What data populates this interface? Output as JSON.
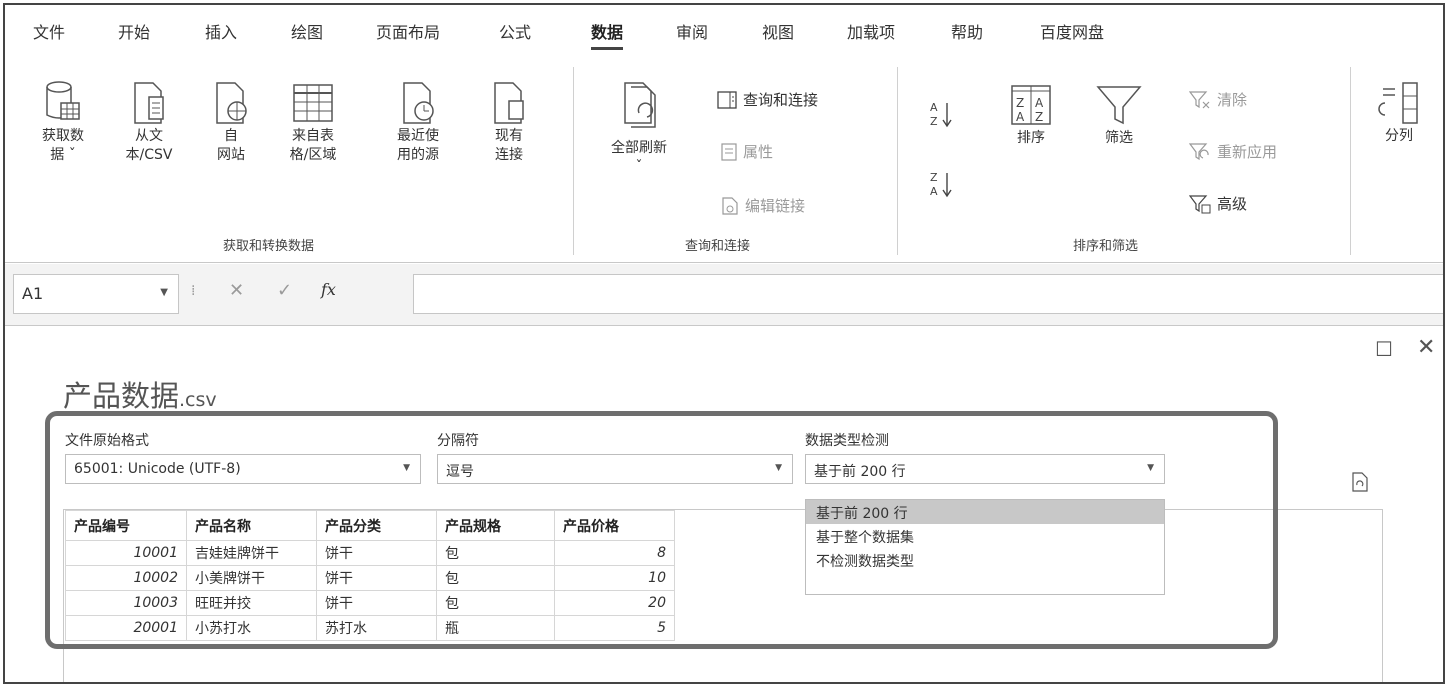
{
  "tabs": [
    "文件",
    "开始",
    "插入",
    "绘图",
    "页面布局",
    "公式",
    "数据",
    "审阅",
    "视图",
    "加载项",
    "帮助",
    "百度网盘"
  ],
  "active_tab": "数据",
  "ribbon": {
    "get_transform": {
      "get_data_l1": "获取数",
      "get_data_l2": "据 ˇ",
      "from_text_l1": "从文",
      "from_text_l2": "本/CSV",
      "from_web_l1": "自",
      "from_web_l2": "网站",
      "from_table_l1": "来自表",
      "from_table_l2": "格/区域",
      "recent_l1": "最近使",
      "recent_l2": "用的源",
      "existing_l1": "现有",
      "existing_l2": "连接",
      "group_label": "获取和转换数据"
    },
    "queries": {
      "refresh_all_l1": "全部刷新",
      "refresh_all_l2": "ˇ",
      "queries_connections": "查询和连接",
      "properties": "属性",
      "edit_links": "编辑链接",
      "group_label": "查询和连接"
    },
    "sort_filter": {
      "sort": "排序",
      "filter": "筛选",
      "clear": "清除",
      "reapply": "重新应用",
      "advanced": "高级",
      "group_label": "排序和筛选"
    },
    "data_tools": {
      "split": "分列"
    }
  },
  "formula_bar": {
    "cell_ref": "A1",
    "fx": "fx",
    "value": ""
  },
  "dialog": {
    "title": "产品数据",
    "title_ext": ".csv",
    "origin_label": "文件原始格式",
    "origin_value": "65001: Unicode (UTF-8)",
    "delimiter_label": "分隔符",
    "delimiter_value": "逗号",
    "detect_label": "数据类型检测",
    "detect_value": "基于前 200 行",
    "detect_options": [
      "基于前 200 行",
      "基于整个数据集",
      "不检测数据类型"
    ],
    "selected_option_index": 0
  },
  "preview": {
    "columns": [
      "产品编号",
      "产品名称",
      "产品分类",
      "产品规格",
      "产品价格"
    ],
    "rows": [
      [
        "10001",
        "吉娃娃牌饼干",
        "饼干",
        "包",
        "8"
      ],
      [
        "10002",
        "小美牌饼干",
        "饼干",
        "包",
        "10"
      ],
      [
        "10003",
        "旺旺并挍",
        "饼干",
        "包",
        "20"
      ],
      [
        "20001",
        "小苏打水",
        "苏打水",
        "瓶",
        "5"
      ]
    ]
  },
  "colors": {
    "highlight_border": "#6e6e6e",
    "selected_option_bg": "#c8c8c8"
  }
}
